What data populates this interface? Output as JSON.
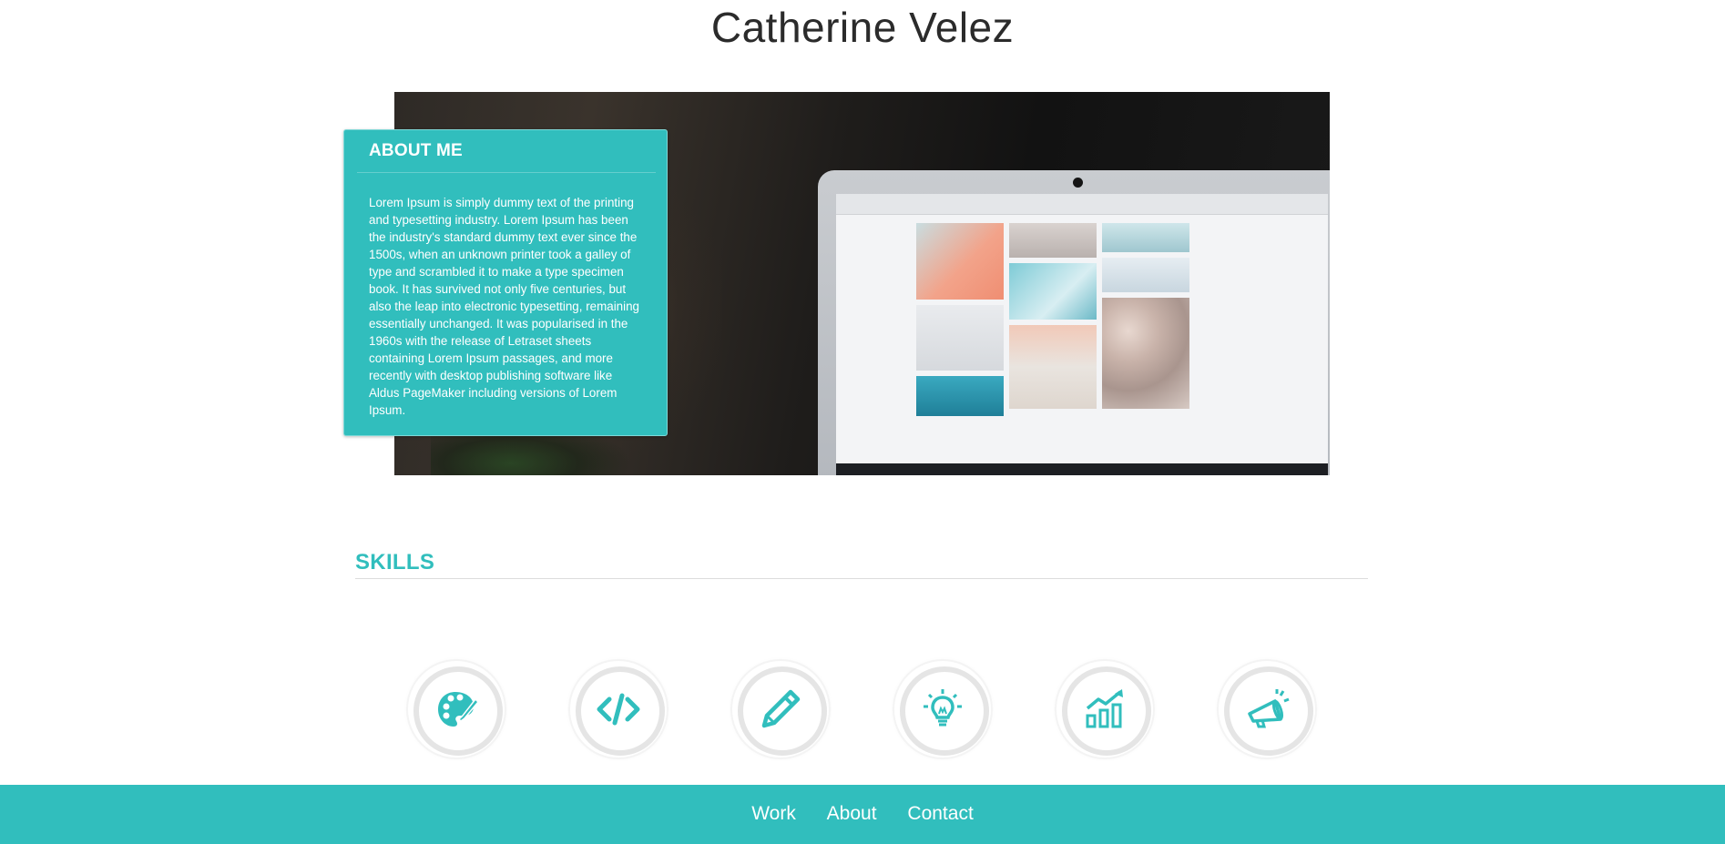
{
  "header": {
    "title": "Catherine Velez"
  },
  "about": {
    "heading": "ABOUT ME",
    "body": "Lorem Ipsum is simply dummy text of the printing and typesetting industry. Lorem Ipsum has been the industry's standard dummy text ever since the 1500s, when an unknown printer took a galley of type and scrambled it to make a type specimen book. It has survived not only five centuries, but also the leap into electronic typesetting, remaining essentially unchanged. It was popularised in the 1960s with the release of Letraset sheets containing Lorem Ipsum passages, and more recently with desktop publishing software like Aldus PageMaker including versions of Lorem Ipsum."
  },
  "skills": {
    "heading": "SKILLS",
    "items": [
      {
        "icon": "palette-icon"
      },
      {
        "icon": "code-icon"
      },
      {
        "icon": "pencil-icon"
      },
      {
        "icon": "lightbulb-icon"
      },
      {
        "icon": "growth-chart-icon"
      },
      {
        "icon": "megaphone-icon"
      }
    ]
  },
  "footer": {
    "links": [
      "Work",
      "About",
      "Contact"
    ]
  },
  "colors": {
    "accent": "#31bebd",
    "title": "#2b2b2b",
    "ring": "#e5e5e5"
  }
}
